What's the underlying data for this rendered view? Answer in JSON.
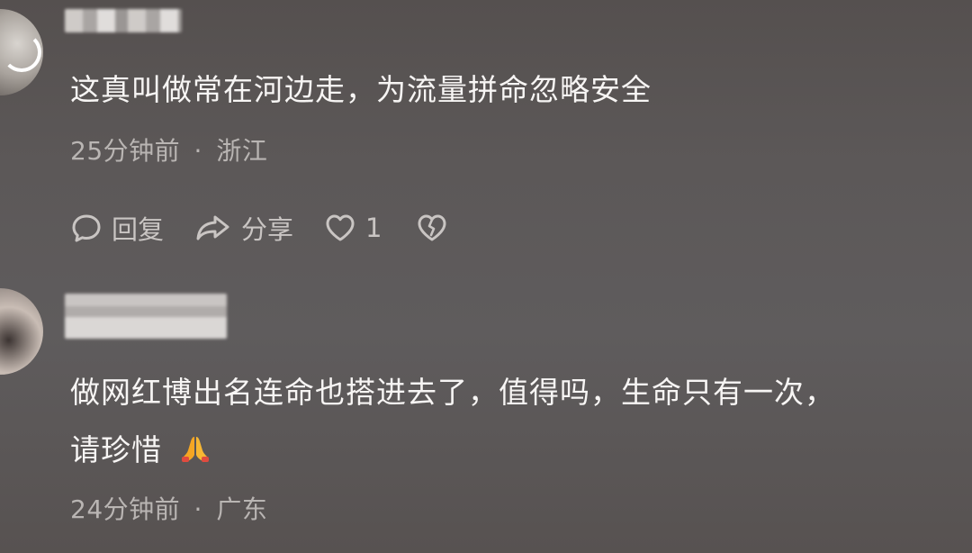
{
  "comments": [
    {
      "text": "这真叫做常在河边走，为流量拼命忽略安全",
      "time": "25分钟前",
      "separator": "·",
      "location": "浙江",
      "actions": {
        "reply_label": "回复",
        "share_label": "分享",
        "like_count": "1"
      }
    },
    {
      "text_line1": "做网红博出名连命也搭进去了，值得吗，生命只有一次，",
      "text_line2": "请珍惜",
      "emoji": "pray-hands",
      "time": "24分钟前",
      "separator": "·",
      "location": "广东"
    }
  ]
}
